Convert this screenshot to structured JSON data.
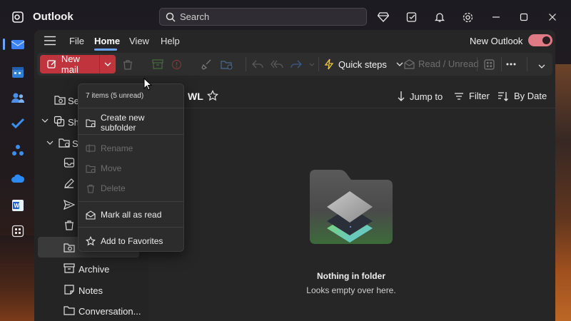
{
  "window": {
    "app_title": "Outlook"
  },
  "search": {
    "placeholder": "Search"
  },
  "menu": {
    "file": "File",
    "home": "Home",
    "view": "View",
    "help": "Help",
    "new_outlook": "New Outlook"
  },
  "ribbon": {
    "new_mail": "New mail",
    "quick_steps": "Quick steps",
    "read_unread": "Read / Unread"
  },
  "folder_pane": {
    "partial_labels": [
      "Sea",
      "Sha",
      "Se"
    ],
    "archive": "Archive",
    "notes": "Notes",
    "conversation": "Conversation..."
  },
  "list_header": {
    "folder_title": "WL",
    "jump_to": "Jump to",
    "filter": "Filter",
    "sort": "By Date"
  },
  "empty_state": {
    "title": "Nothing in folder",
    "subtitle": "Looks empty over here."
  },
  "context_menu": {
    "header": "7 items (5 unread)",
    "create_subfolder": "Create new subfolder",
    "rename": "Rename",
    "move": "Move",
    "delete": "Delete",
    "mark_all_read": "Mark all as read",
    "add_favorites": "Add to Favorites"
  },
  "colors": {
    "accent": "#6ba4ff",
    "new_mail_bg": "#c0343e",
    "toggle_on": "#e07b86"
  }
}
